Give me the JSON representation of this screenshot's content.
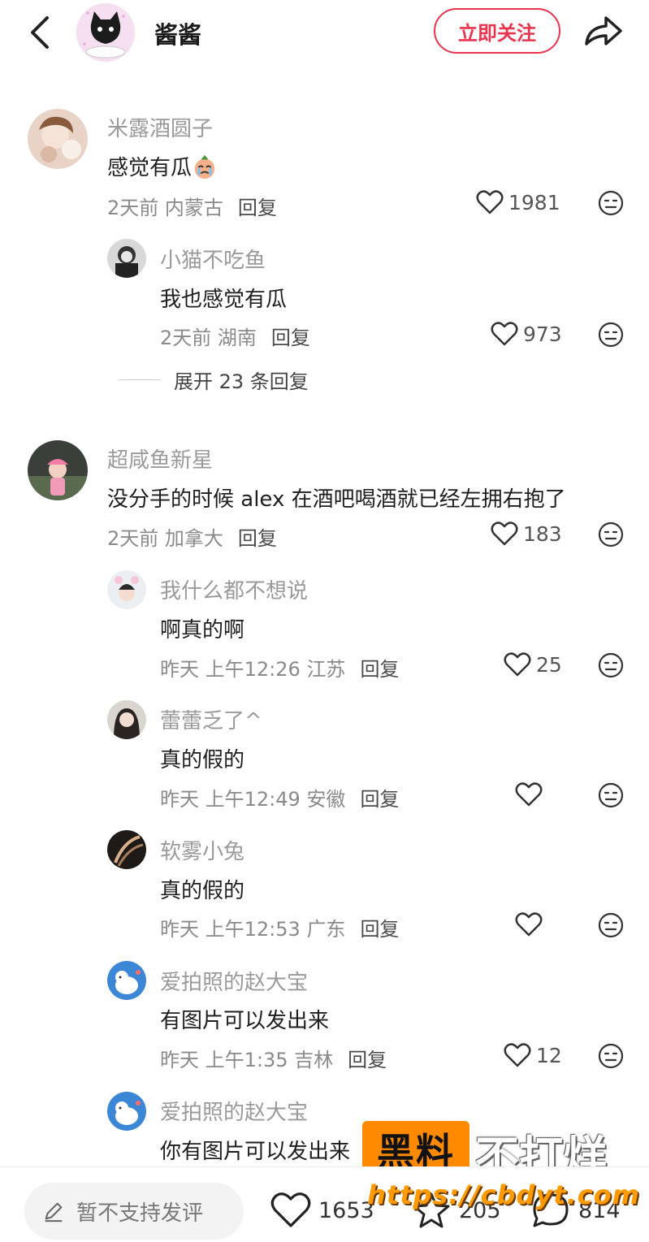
{
  "header": {
    "username": "酱酱",
    "follow_label": "立即关注",
    "back_icon": "chevron-left-icon",
    "share_icon": "share-arrow-icon"
  },
  "comments": [
    {
      "user": "米露酒圆子",
      "text": "感觉有瓜",
      "time": "2天前",
      "location": "内蒙古",
      "reply_label": "回复",
      "likes": "1981",
      "replies": [
        {
          "user": "小猫不吃鱼",
          "text": "我也感觉有瓜",
          "time": "2天前",
          "location": "湖南",
          "reply_label": "回复",
          "likes": "973"
        }
      ],
      "expand_label": "展开 23 条回复"
    },
    {
      "user": "超咸鱼新星",
      "text": "没分手的时候 alex 在酒吧喝酒就已经左拥右抱了",
      "time": "2天前",
      "location": "加拿大",
      "reply_label": "回复",
      "likes": "183",
      "replies": [
        {
          "user": "我什么都不想说",
          "text": "啊真的啊",
          "time": "昨天 上午12:26",
          "location": "江苏",
          "reply_label": "回复",
          "likes": "25"
        },
        {
          "user": "蕾蕾乏了^",
          "text": "真的假的",
          "time": "昨天 上午12:49",
          "location": "安徽",
          "reply_label": "回复",
          "likes": ""
        },
        {
          "user": "软雾小兔",
          "text": "真的假的",
          "time": "昨天 上午12:53",
          "location": "广东",
          "reply_label": "回复",
          "likes": ""
        },
        {
          "user": "爱拍照的赵大宝",
          "text": "有图片可以发出来",
          "time": "昨天 上午1:35",
          "location": "吉林",
          "reply_label": "回复",
          "likes": "12"
        },
        {
          "user": "爱拍照的赵大宝",
          "text": "你有图片可以发出来",
          "time": "",
          "location": "",
          "reply_label": "",
          "likes": ""
        }
      ]
    }
  ],
  "bottom_bar": {
    "input_placeholder": "暂不支持发评",
    "likes": "1653",
    "favorites": "205",
    "comments": "814"
  },
  "watermark": {
    "box_text": "黑料",
    "text": "不打烊",
    "url": "https://cbdyt.com"
  },
  "colors": {
    "accent": "#e8344e",
    "watermark_orange": "#ff8a00"
  }
}
